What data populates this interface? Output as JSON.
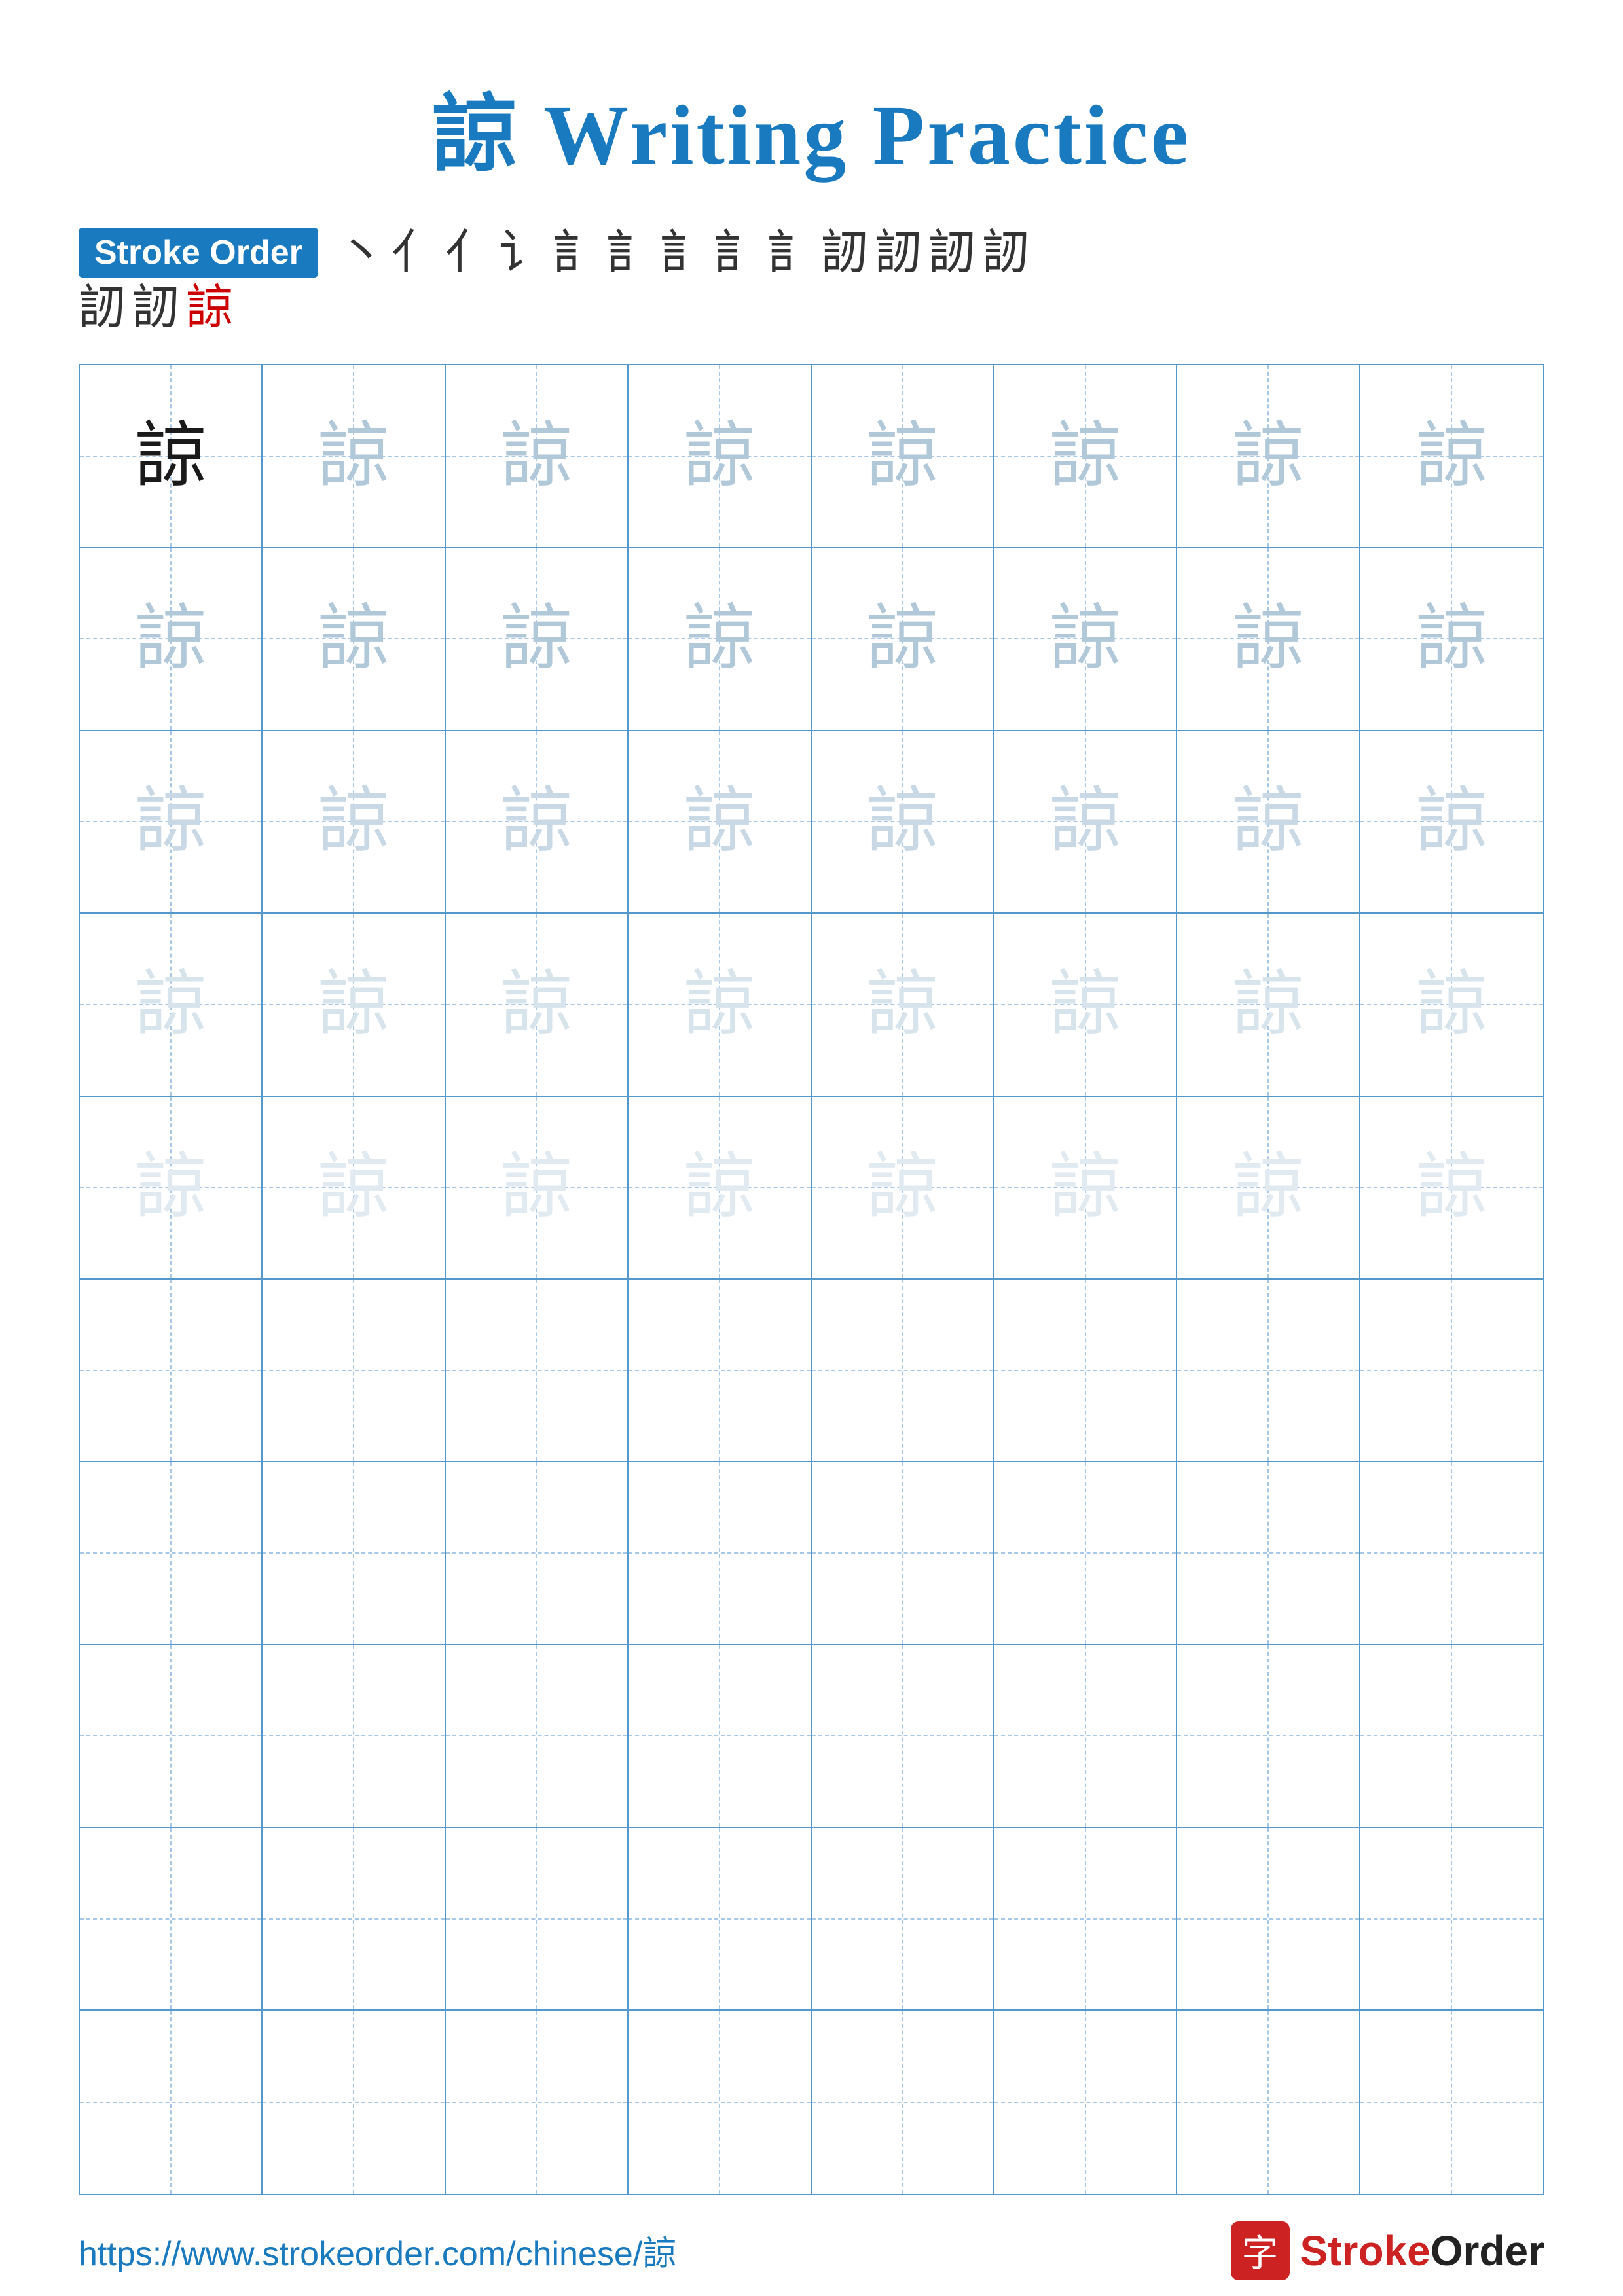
{
  "title": "諒 Writing Practice",
  "stroke_order": {
    "badge_label": "Stroke Order",
    "chars_row1": [
      "丶",
      "亻",
      "亻",
      "讠",
      "訁",
      "訁",
      "訁",
      "訁",
      "訁",
      "訒",
      "訒",
      "訒",
      "訒"
    ],
    "chars_row2": [
      "訒",
      "訒",
      "諒"
    ]
  },
  "character": "諒",
  "grid": {
    "rows": 10,
    "cols": 8,
    "practice_rows": [
      [
        "dark",
        "light1",
        "light1",
        "light1",
        "light1",
        "light1",
        "light1",
        "light1"
      ],
      [
        "light1",
        "light1",
        "light1",
        "light1",
        "light1",
        "light1",
        "light1",
        "light1"
      ],
      [
        "light2",
        "light2",
        "light2",
        "light2",
        "light2",
        "light2",
        "light2",
        "light2"
      ],
      [
        "light3",
        "light3",
        "light3",
        "light3",
        "light3",
        "light3",
        "light3",
        "light3"
      ],
      [
        "light4",
        "light4",
        "light4",
        "light4",
        "light4",
        "light4",
        "light4",
        "light4"
      ],
      [
        "empty",
        "empty",
        "empty",
        "empty",
        "empty",
        "empty",
        "empty",
        "empty"
      ],
      [
        "empty",
        "empty",
        "empty",
        "empty",
        "empty",
        "empty",
        "empty",
        "empty"
      ],
      [
        "empty",
        "empty",
        "empty",
        "empty",
        "empty",
        "empty",
        "empty",
        "empty"
      ],
      [
        "empty",
        "empty",
        "empty",
        "empty",
        "empty",
        "empty",
        "empty",
        "empty"
      ],
      [
        "empty",
        "empty",
        "empty",
        "empty",
        "empty",
        "empty",
        "empty",
        "empty"
      ]
    ]
  },
  "footer": {
    "url": "https://www.strokeorder.com/chinese/諒",
    "logo_char": "字",
    "logo_text": "StrokeOrder"
  }
}
